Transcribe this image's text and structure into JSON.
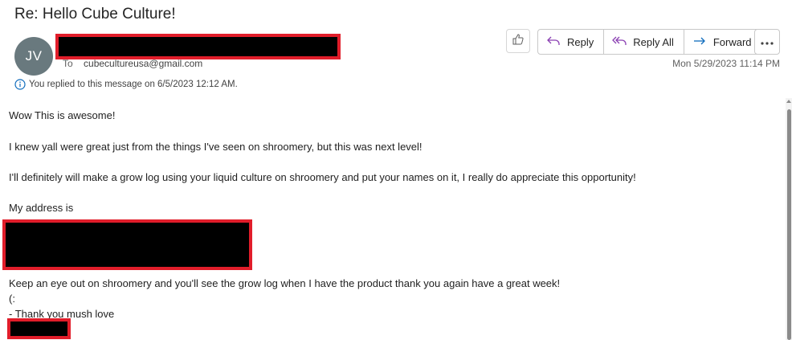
{
  "email": {
    "subject": "Re: Hello Cube Culture!",
    "sender_initials": "JV",
    "to_label": "To",
    "to_address": "cubecultureusa@gmail.com",
    "replied_notice": "You replied to this message on 6/5/2023 12:12 AM.",
    "date": "Mon 5/29/2023 11:14 PM"
  },
  "toolbar": {
    "reply_label": "Reply",
    "reply_all_label": "Reply All",
    "forward_label": "Forward"
  },
  "body": {
    "line1": "Wow This is awesome!",
    "line2": "I knew yall were great just from the things I've seen on shroomery, but this was next level!",
    "line3": "I'll definitely will make a grow log using your liquid culture on shroomery and put your names on it, I really do appreciate this opportunity!",
    "line4": "My address is",
    "line5": "Keep an eye out on shroomery and you'll see the grow log when I have the product thank you again have a great week!",
    "line6": "(:",
    "line7": "- Thank you mush love"
  },
  "colors": {
    "avatar_bg": "#69797e",
    "redaction_border": "#e11d2a",
    "accent_blue": "#0f6cbd",
    "reply_all_purple": "#8a3fb2"
  },
  "icons": {
    "like": "thumbs-up-icon",
    "reply": "reply-arrow-icon",
    "reply_all": "reply-all-arrow-icon",
    "forward": "forward-arrow-icon",
    "more": "more-ellipsis-icon",
    "info": "info-icon"
  }
}
